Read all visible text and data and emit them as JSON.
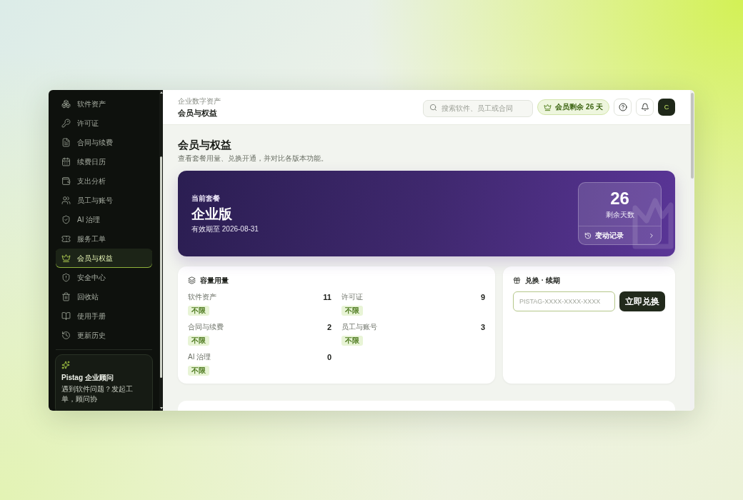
{
  "sidebar": {
    "items": [
      {
        "label": "软件资产",
        "selected": false
      },
      {
        "label": "许可证",
        "selected": false
      },
      {
        "label": "合同与续费",
        "selected": false
      },
      {
        "label": "续费日历",
        "selected": false
      },
      {
        "label": "支出分析",
        "selected": false
      },
      {
        "label": "员工与账号",
        "selected": false
      },
      {
        "label": "AI 治理",
        "selected": false
      },
      {
        "label": "服务工单",
        "selected": false
      },
      {
        "label": "会员与权益",
        "selected": true
      },
      {
        "label": "安全中心",
        "selected": false
      },
      {
        "label": "回收站",
        "selected": false
      },
      {
        "label": "使用手册",
        "selected": false
      },
      {
        "label": "更新历史",
        "selected": false
      }
    ],
    "advisor_card": {
      "title": "Pistag 企业顾问",
      "text": "遇到软件问题？发起工单，顾问协"
    }
  },
  "header": {
    "breadcrumb": "企业数字资产",
    "title": "会员与权益",
    "search": {
      "placeholder": "搜索软件、员工或合同"
    },
    "membership_badge": "会员剩余 26 天",
    "avatar": "C"
  },
  "page": {
    "title": "会员与权益",
    "subtitle": "查看套餐用量、兑换开通，并对比各版本功能。"
  },
  "plan_banner": {
    "label": "当前套餐",
    "plan": "企业版",
    "valid_until": "有效期至 2026-08-31",
    "days_left": "26",
    "days_left_label": "剩余天数",
    "history_link": "变动记录"
  },
  "usage": {
    "title": "容量用量",
    "items": [
      {
        "label": "软件资产",
        "value": "11",
        "limit": "不限"
      },
      {
        "label": "许可证",
        "value": "9",
        "limit": "不限"
      },
      {
        "label": "合同与续费",
        "value": "2",
        "limit": "不限"
      },
      {
        "label": "员工与账号",
        "value": "3",
        "limit": "不限"
      },
      {
        "label": "AI 治理",
        "value": "0",
        "limit": "不限"
      }
    ]
  },
  "redeem": {
    "title": "兑换 · 续期",
    "code_field": {
      "placeholder": "PISTAG-XXXX-XXXX-XXXX"
    },
    "button": "立即兑换"
  }
}
